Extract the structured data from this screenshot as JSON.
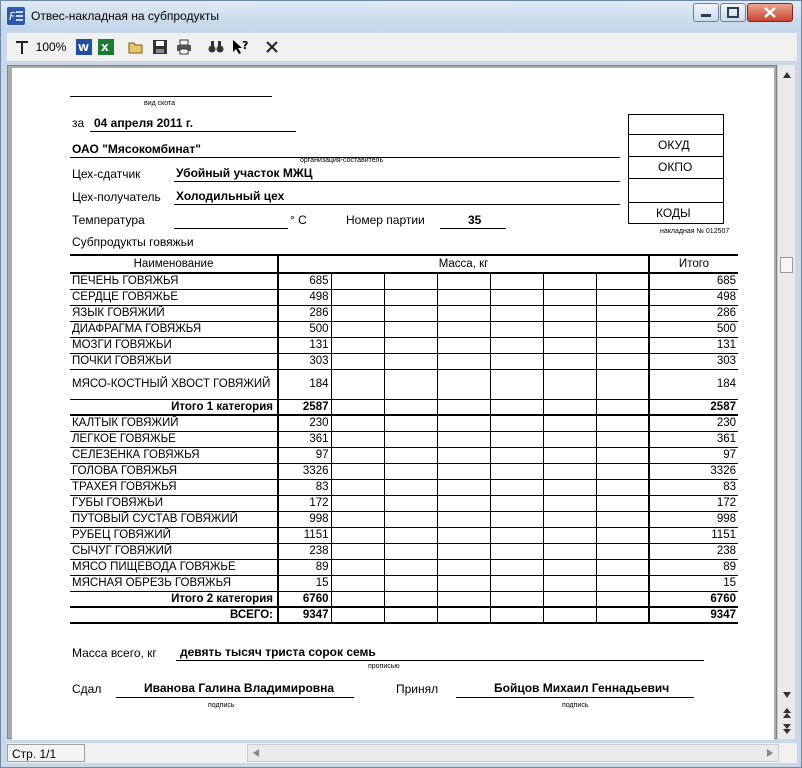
{
  "window": {
    "title": "Отвес-накладная на субпродукты"
  },
  "toolbar": {
    "zoom_label": "100%",
    "icons": [
      "fit-icon",
      "word-icon",
      "excel-icon",
      "open-icon",
      "save-icon",
      "print-icon",
      "find-icon",
      "help-icon",
      "close-icon"
    ]
  },
  "status": {
    "page_label": "Стр. 1/1"
  },
  "doc": {
    "vid_skota_caption": "вид скота",
    "za_label": "за",
    "date": "04 апреля 2011 г.",
    "org": "ОАО \"Мясокомбинат\"",
    "org_caption": "организация-составитель",
    "codes": [
      "ОКУД",
      "ОКПО",
      "",
      "КОДЫ"
    ],
    "nakladnaya_no": "накладная № 012507",
    "sender_label": "Цех-сдатчик",
    "sender": "Убойный участок МЖЦ",
    "receiver_label": "Цех-получатель",
    "receiver": "Холодильный цех",
    "temp_label": "Температура",
    "temp_unit": "° С",
    "batch_label": "Номер партии",
    "batch": "35",
    "category": "Субпродукты говяжьи",
    "table": {
      "headers": [
        "Наименование",
        "Масса, кг",
        "Итого"
      ],
      "group1": [
        {
          "name": "ПЕЧЕНЬ ГОВЯЖЬЯ",
          "mass": "685",
          "total": "685"
        },
        {
          "name": "СЕРДЦЕ ГОВЯЖЬЕ",
          "mass": "498",
          "total": "498"
        },
        {
          "name": "ЯЗЫК ГОВЯЖИЙ",
          "mass": "286",
          "total": "286"
        },
        {
          "name": "ДИАФРАГМА ГОВЯЖЬЯ",
          "mass": "500",
          "total": "500"
        },
        {
          "name": "МОЗГИ ГОВЯЖЬИ",
          "mass": "131",
          "total": "131"
        },
        {
          "name": "ПОЧКИ ГОВЯЖЬИ",
          "mass": "303",
          "total": "303"
        },
        {
          "name": "МЯСО-КОСТНЫЙ ХВОСТ ГОВЯЖИЙ",
          "mass": "184",
          "total": "184"
        }
      ],
      "subtotal1": {
        "name": "Итого 1 категория",
        "mass": "2587",
        "total": "2587"
      },
      "group2": [
        {
          "name": "КАЛТЫК ГОВЯЖИЙ",
          "mass": "230",
          "total": "230"
        },
        {
          "name": "ЛЕГКОЕ ГОВЯЖЬЕ",
          "mass": "361",
          "total": "361"
        },
        {
          "name": "СЕЛЕЗЕНКА ГОВЯЖЬЯ",
          "mass": "97",
          "total": "97"
        },
        {
          "name": "ГОЛОВА ГОВЯЖЬЯ",
          "mass": "3326",
          "total": "3326"
        },
        {
          "name": "ТРАХЕЯ ГОВЯЖЬЯ",
          "mass": "83",
          "total": "83"
        },
        {
          "name": "ГУБЫ ГОВЯЖЬИ",
          "mass": "172",
          "total": "172"
        },
        {
          "name": "ПУТОВЫЙ СУСТАВ ГОВЯЖИЙ",
          "mass": "998",
          "total": "998"
        },
        {
          "name": "РУБЕЦ ГОВЯЖИЙ",
          "mass": "1151",
          "total": "1151"
        },
        {
          "name": "СЫЧУГ ГОВЯЖИЙ",
          "mass": "238",
          "total": "238"
        },
        {
          "name": "МЯСО ПИЩЕВОДА ГОВЯЖЬЕ",
          "mass": "89",
          "total": "89"
        },
        {
          "name": "МЯСНАЯ ОБРЕЗЬ ГОВЯЖЬЯ",
          "mass": "15",
          "total": "15"
        }
      ],
      "subtotal2": {
        "name": "Итого 2 категория",
        "mass": "6760",
        "total": "6760"
      },
      "grand": {
        "name": "ВСЕГО:",
        "mass": "9347",
        "total": "9347"
      }
    },
    "mass_total_label": "Масса всего, кг",
    "mass_total_words": "девять тысяч триста сорок семь",
    "words_caption": "прописью",
    "gave_label": "Сдал",
    "gave_name": "Иванова Галина Владимировна",
    "took_label": "Принял",
    "took_name": "Бойцов Михаил  Геннадьевич",
    "sign_caption": "подпись"
  }
}
